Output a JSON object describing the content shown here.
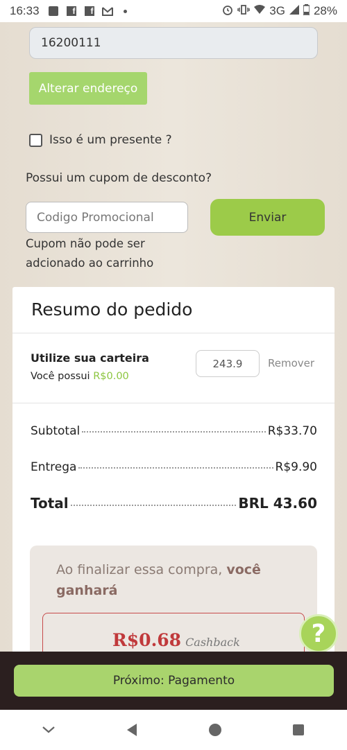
{
  "status_bar": {
    "time": "16:33",
    "network": "3G",
    "battery": "28%"
  },
  "address": {
    "cep_value": "16200111",
    "change_button": "Alterar endereço"
  },
  "gift": {
    "label": "Isso é um presente ?",
    "checked": false
  },
  "coupon": {
    "question": "Possui um cupom de desconto?",
    "placeholder": "Codigo Promocional",
    "send_button": "Enviar",
    "error": "Cupom não pode ser adcionado ao carrinho"
  },
  "summary": {
    "title": "Resumo do pedido",
    "wallet": {
      "title": "Utilize sua carteira",
      "has_label": "Você possui",
      "balance": "R$0.00",
      "input_value": "243.9",
      "remove_label": "Remover"
    },
    "subtotal_label": "Subtotal",
    "subtotal_value": "R$33.70",
    "shipping_label": "Entrega",
    "shipping_value": "R$9.90",
    "total_label": "Total",
    "total_value": "BRL 43.60"
  },
  "cashback": {
    "text": "Ao finalizar essa compra,",
    "text_bold": "você ganhará",
    "amount": "R$0.68",
    "amount_label": "Cashback"
  },
  "help": {
    "label": "?"
  },
  "footer": {
    "next_button": "Próximo: Pagamento"
  },
  "colors": {
    "accent_green": "#a5d66d",
    "cashback_red": "#c0393b",
    "footer_bg": "#2b1f1f"
  }
}
